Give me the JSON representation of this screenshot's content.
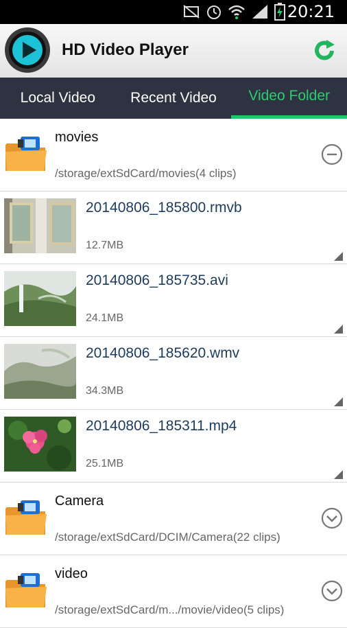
{
  "status": {
    "time": "20:21"
  },
  "app": {
    "title": "HD Video Player"
  },
  "tabs": [
    {
      "label": "Local Video",
      "active": false
    },
    {
      "label": "Recent Video",
      "active": false
    },
    {
      "label": "Video Folder",
      "active": true
    }
  ],
  "list": [
    {
      "type": "folder",
      "name": "movies",
      "path": "/storage/extSdCard/movies(4 clips)",
      "state": "expanded"
    },
    {
      "type": "file",
      "name": "20140806_185800.rmvb",
      "size": "12.7MB",
      "thumb": "room-paintings"
    },
    {
      "type": "file",
      "name": "20140806_185735.avi",
      "size": "24.1MB",
      "thumb": "waterfall-landscape"
    },
    {
      "type": "file",
      "name": "20140806_185620.wmv",
      "size": "34.3MB",
      "thumb": "misty-mountains"
    },
    {
      "type": "file",
      "name": "20140806_185311.mp4",
      "size": "25.1MB",
      "thumb": "pink-flower"
    },
    {
      "type": "folder",
      "name": "Camera",
      "path": "/storage/extSdCard/DCIM/Camera(22 clips)",
      "state": "collapsed"
    },
    {
      "type": "folder",
      "name": "video",
      "path": "/storage/extSdCard/m.../movie/video(5 clips)",
      "state": "collapsed"
    }
  ],
  "colors": {
    "accent": "#27c26a",
    "tabbar": "#2d3340",
    "filename": "#1d3b5c"
  }
}
